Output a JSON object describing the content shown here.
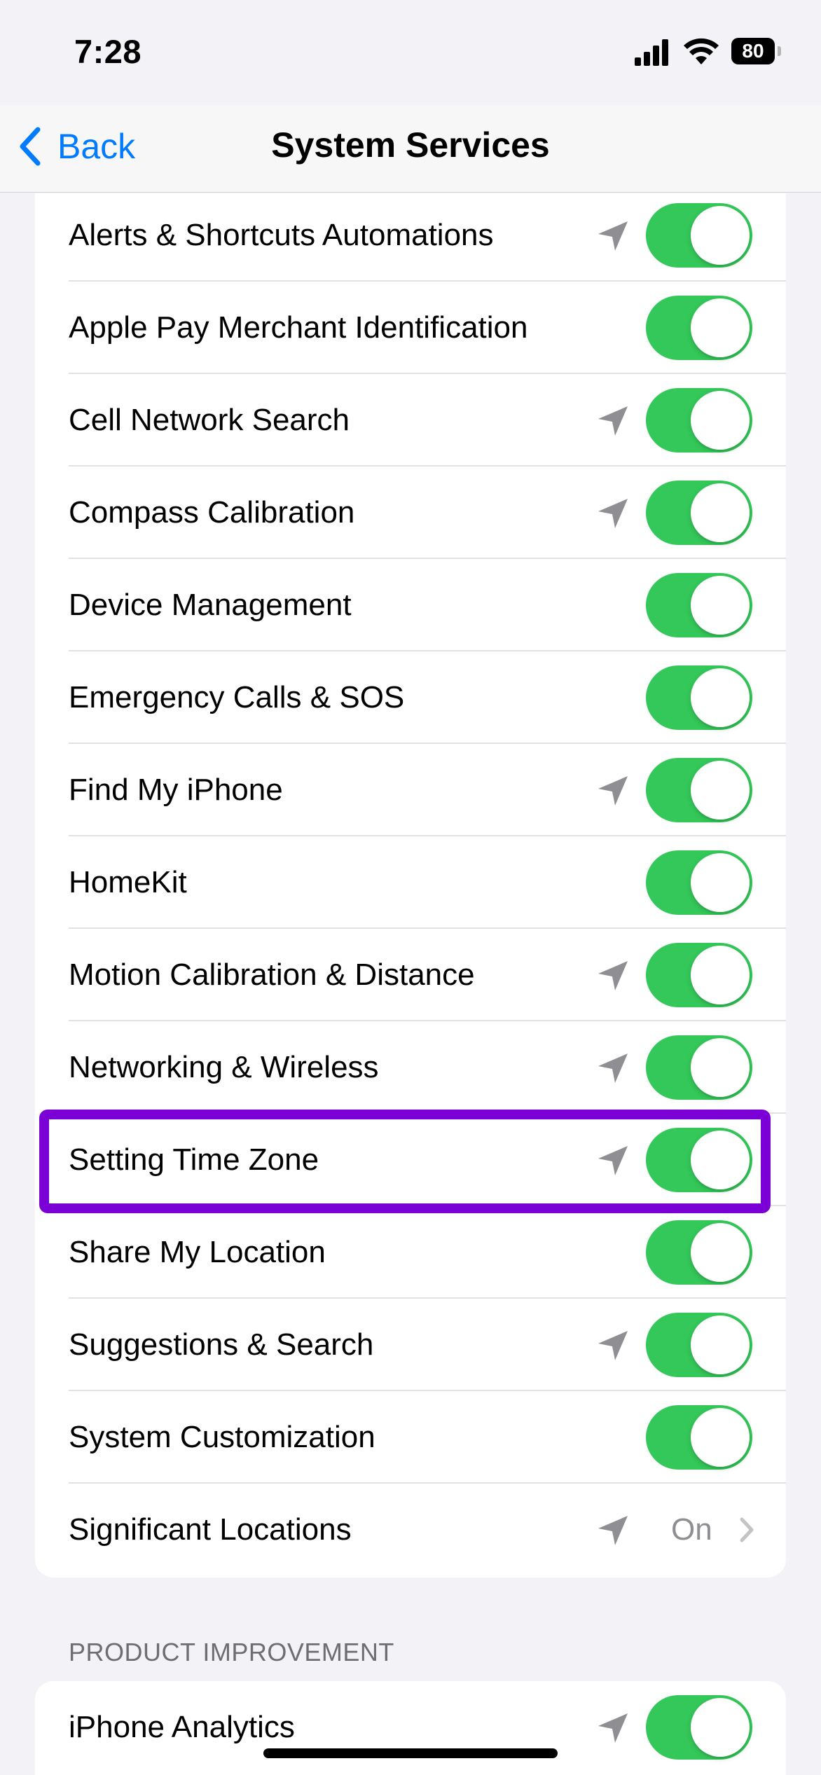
{
  "status_bar": {
    "time": "7:28",
    "battery_level": "80"
  },
  "nav": {
    "back_label": "Back",
    "title": "System Services"
  },
  "icons": {
    "location": "location-arrow-icon",
    "chevron": "chevron-right-icon",
    "back": "chevron-left-icon"
  },
  "colors": {
    "toggle_on": "#34c759",
    "accent": "#007aff",
    "highlight": "#7a00d6"
  },
  "services": [
    {
      "label": "Alerts & Shortcuts Automations",
      "location_icon": true,
      "enabled": true
    },
    {
      "label": "Apple Pay Merchant Identification",
      "location_icon": false,
      "enabled": true
    },
    {
      "label": "Cell Network Search",
      "location_icon": true,
      "enabled": true
    },
    {
      "label": "Compass Calibration",
      "location_icon": true,
      "enabled": true
    },
    {
      "label": "Device Management",
      "location_icon": false,
      "enabled": true
    },
    {
      "label": "Emergency Calls & SOS",
      "location_icon": false,
      "enabled": true
    },
    {
      "label": "Find My iPhone",
      "location_icon": true,
      "enabled": true
    },
    {
      "label": "HomeKit",
      "location_icon": false,
      "enabled": true
    },
    {
      "label": "Motion Calibration & Distance",
      "location_icon": true,
      "enabled": true
    },
    {
      "label": "Networking & Wireless",
      "location_icon": true,
      "enabled": true
    },
    {
      "label": "Setting Time Zone",
      "location_icon": true,
      "enabled": true,
      "highlighted": true
    },
    {
      "label": "Share My Location",
      "location_icon": false,
      "enabled": true
    },
    {
      "label": "Suggestions & Search",
      "location_icon": true,
      "enabled": true
    },
    {
      "label": "System Customization",
      "location_icon": false,
      "enabled": true
    }
  ],
  "significant_locations": {
    "label": "Significant Locations",
    "value": "On"
  },
  "product_improvement": {
    "header": "PRODUCT IMPROVEMENT",
    "items": [
      {
        "label": "iPhone Analytics",
        "location_icon": true,
        "enabled": true
      }
    ]
  }
}
